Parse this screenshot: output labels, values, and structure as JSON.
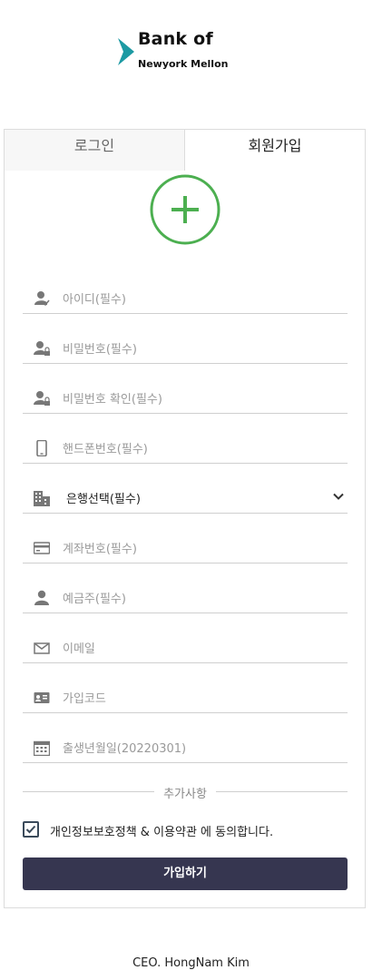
{
  "logo": {
    "line1": "Bank of",
    "line2": "Newyork Mellon",
    "mark_color": "#1d9aa3"
  },
  "tabs": {
    "login": "로그인",
    "signup": "회원가입"
  },
  "accent": "#4caf50",
  "fields": [
    {
      "icon": "user-check-icon",
      "placeholder": "아이디(필수)"
    },
    {
      "icon": "user-lock-icon",
      "placeholder": "비밀번호(필수)"
    },
    {
      "icon": "user-lock-icon",
      "placeholder": "비밀번호 확인(필수)"
    },
    {
      "icon": "phone-icon",
      "placeholder": "핸드폰번호(필수)"
    },
    {
      "icon": "building-icon",
      "selected": "은행선택(필수)"
    },
    {
      "icon": "credit-card-icon",
      "placeholder": "계좌번호(필수)"
    },
    {
      "icon": "user-icon",
      "placeholder": "예금주(필수)"
    },
    {
      "icon": "envelope-icon",
      "placeholder": "이메일"
    },
    {
      "icon": "id-card-icon",
      "placeholder": "가입코드"
    },
    {
      "icon": "calendar-icon",
      "placeholder": "출생년월일(20220301)"
    }
  ],
  "extra_label": "추가사항",
  "agree_text": "개인정보보호정책 & 이용약관 에 동의합니다.",
  "agree_checked": true,
  "submit_label": "가입하기",
  "submit_color": "#363650",
  "footer": "CEO. HongNam Kim"
}
